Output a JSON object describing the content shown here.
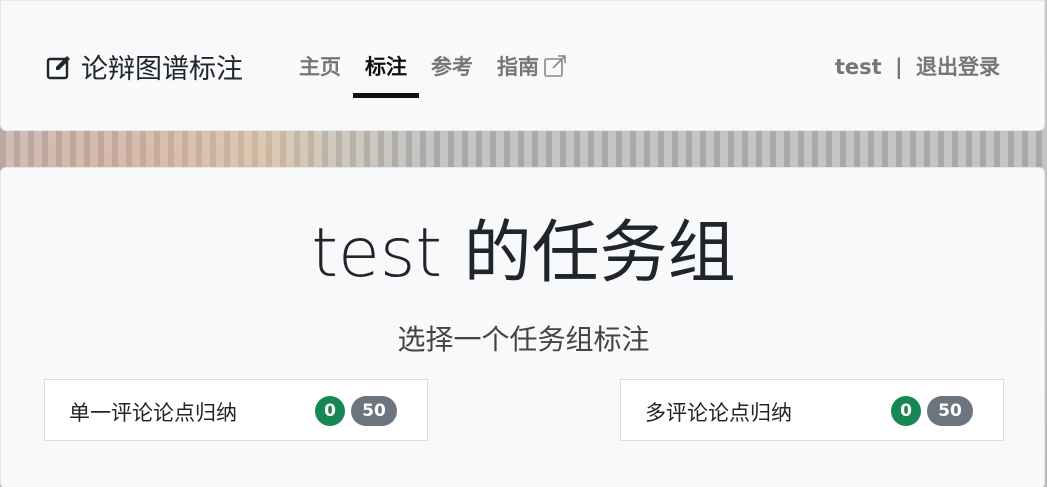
{
  "brand": {
    "title": "论辩图谱标注",
    "icon": "edit-icon"
  },
  "nav": {
    "items": [
      {
        "label": "主页"
      },
      {
        "label": "标注"
      },
      {
        "label": "参考"
      },
      {
        "label": "指南",
        "icon": "external-link-icon"
      }
    ],
    "active": "标注"
  },
  "user": {
    "name": "test",
    "separator": "|",
    "logout": "退出登录"
  },
  "main": {
    "title": "test 的任务组",
    "subtitle": "选择一个任务组标注",
    "cards": [
      {
        "label": "单一评论论点归纳",
        "done": "0",
        "total": "50"
      },
      {
        "label": "多评论论点归纳",
        "done": "0",
        "total": "50"
      }
    ]
  },
  "colors": {
    "badge_done": "#198754",
    "badge_total": "#6c757d",
    "active_underline": "#111111"
  }
}
